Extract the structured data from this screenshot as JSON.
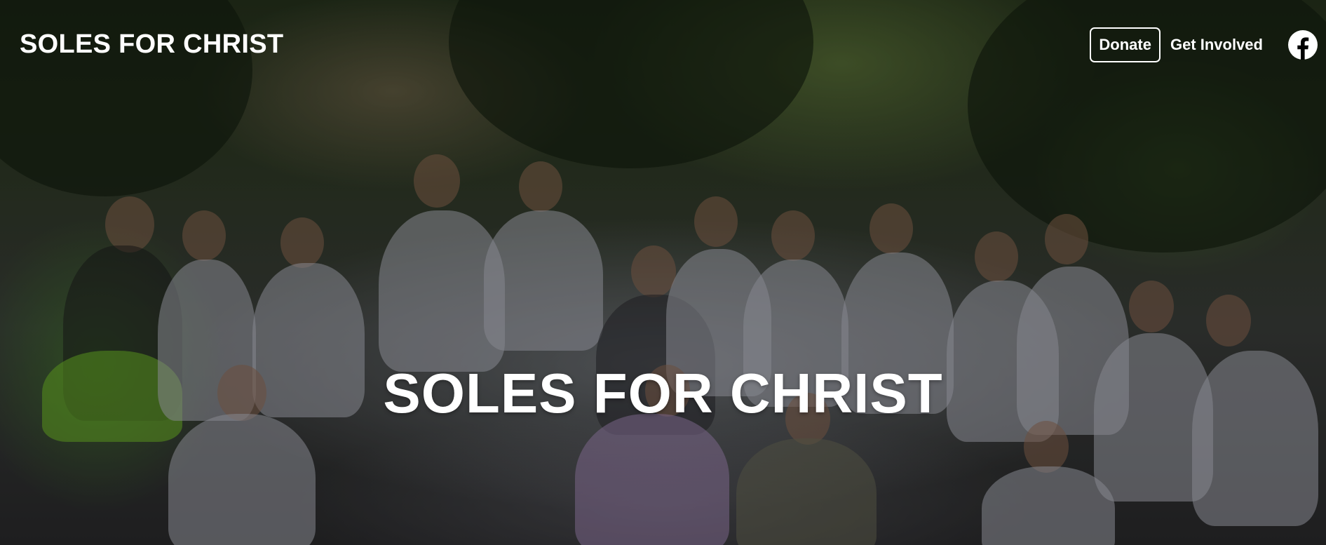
{
  "header": {
    "brand": "SOLES FOR CHRIST",
    "nav": {
      "donate_label": "Donate",
      "get_involved_label": "Get Involved",
      "social_icon": "facebook-icon"
    }
  },
  "hero": {
    "title": "SOLES FOR CHRIST",
    "background": "group-photo"
  },
  "colors": {
    "text": "#ffffff"
  }
}
